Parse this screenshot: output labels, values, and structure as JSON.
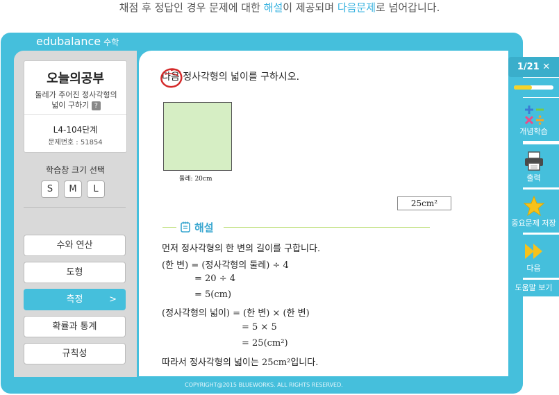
{
  "caption": {
    "before": "채점 후 정답인 경우 문제에 대한 ",
    "hl1": "해설",
    "mid": "이 제공되며 ",
    "hl2": "다음문제",
    "after": "로 넘어갑니다."
  },
  "brand": {
    "name": "edubalance",
    "sub": "수학"
  },
  "info": {
    "title": "오늘의공부",
    "desc": "둘레가 주어진 정사각형의 넓이 구하기",
    "help": "?",
    "level": "L4-104단계",
    "qnum": "문제번호 : 51854"
  },
  "size": {
    "label": "학습창 크기 선택",
    "buttons": [
      "S",
      "M",
      "L"
    ]
  },
  "categories": [
    {
      "label": "수와 연산",
      "active": false
    },
    {
      "label": "도형",
      "active": false
    },
    {
      "label": "측정",
      "active": true
    },
    {
      "label": "확률과 통계",
      "active": false
    },
    {
      "label": "규칙성",
      "active": false
    }
  ],
  "question": {
    "text": "다음 정사각형의 넓이를 구하시오.",
    "perimeter": "둘레: 20cm",
    "answer": "25cm²"
  },
  "explanation": {
    "title": "해설",
    "lines": [
      "먼저 정사각형의 한 변의 길이를 구합니다.",
      "(한 변) = (정사각형의 둘레) ÷ 4",
      "= 20 ÷ 4",
      "= 5(cm)",
      "(정사각형의 넓이) = (한 변) × (한 변)",
      "= 5 × 5",
      "= 25(cm²)",
      "따라서 정사각형의 넓이는 25cm²입니다."
    ]
  },
  "right_panel": {
    "counter": "1/21 ✕",
    "progress": 0.45,
    "concept": "개념학습",
    "print": "출력",
    "save": "중요문제 저장",
    "next": "다음",
    "help": "도움말 보기"
  },
  "footer": "COPYRIGHT@2015 BLUEWORKS. ALL RIGHTS RESERVED.",
  "colors": {
    "accent": "#45bfdc",
    "highlight": "#3ab3e0",
    "progress": "#f5d32a",
    "star": "#f6c21b"
  }
}
